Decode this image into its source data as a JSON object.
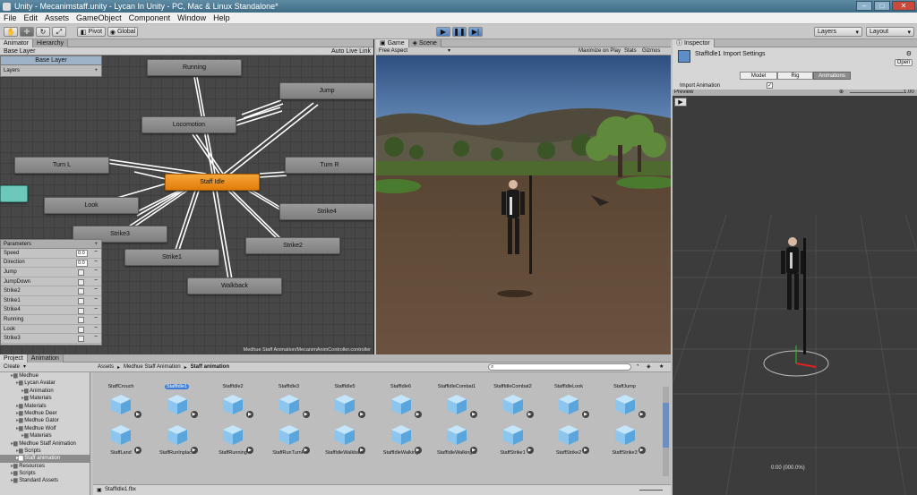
{
  "window": {
    "title": "Unity - Mecanimstaff.unity - Lycan In Unity - PC, Mac & Linux Standalone*"
  },
  "menu": [
    "File",
    "Edit",
    "Assets",
    "GameObject",
    "Component",
    "Window",
    "Help"
  ],
  "toolbar": {
    "pivot": "Pivot",
    "global": "Global",
    "layers": "Layers",
    "layout": "Layout"
  },
  "animator": {
    "tabs": [
      "Animator",
      "Hierarchy"
    ],
    "base_layer_tab": "Base Layer",
    "auto_live_link": "Auto Live Link",
    "layer_name": "Base Layer",
    "layers_label": "Layers",
    "states": [
      "Running",
      "Jump",
      "Locomotion",
      "Turn L",
      "Turn R",
      "Staff Idle",
      "Look",
      "Strike4",
      "Strike3",
      "Strike2",
      "Strike1",
      "Walkback"
    ],
    "params_label": "Parameters",
    "params": [
      {
        "name": "Speed",
        "value": "0.0"
      },
      {
        "name": "Direction",
        "value": "0.0"
      },
      {
        "name": "Jump",
        "value": ""
      },
      {
        "name": "JumpDown",
        "value": ""
      },
      {
        "name": "Strike2",
        "value": ""
      },
      {
        "name": "Strike1",
        "value": ""
      },
      {
        "name": "Strike4",
        "value": ""
      },
      {
        "name": "Running",
        "value": ""
      },
      {
        "name": "Look",
        "value": ""
      },
      {
        "name": "Strike3",
        "value": ""
      }
    ],
    "controller_path": "Medhue Staff Animation/MecanimAnimController.controller"
  },
  "game": {
    "tabs": [
      "Game",
      "Scene"
    ],
    "aspect": "Free Aspect",
    "maximize": "Maximize on Play",
    "stats": "Stats",
    "gizmos": "Gizmos"
  },
  "inspector": {
    "tab": "Inspector",
    "title": "StaffIdle1 Import Settings",
    "open": "Open",
    "tabs": [
      "Model",
      "Rig",
      "Animations"
    ],
    "import_animation": "Import Animation",
    "preview": "Preview",
    "speed": "1.00",
    "time_readout": "0:00 (000.0%)"
  },
  "project": {
    "tabs": [
      "Project",
      "Animation"
    ],
    "create": "Create",
    "breadcrumb": [
      "Assets",
      "Medhue Staff Animation",
      "Staff animation"
    ],
    "tree": [
      {
        "label": "Medhue",
        "indent": 2,
        "sel": false
      },
      {
        "label": "Lycan Avatar",
        "indent": 3,
        "sel": false
      },
      {
        "label": "Animation",
        "indent": 4,
        "sel": false
      },
      {
        "label": "Materials",
        "indent": 4,
        "sel": false
      },
      {
        "label": "Materials",
        "indent": 3,
        "sel": false
      },
      {
        "label": "Medhue Deer",
        "indent": 3,
        "sel": false
      },
      {
        "label": "Medhue Gator",
        "indent": 3,
        "sel": false
      },
      {
        "label": "Medhue Wolf",
        "indent": 3,
        "sel": false
      },
      {
        "label": "Materials",
        "indent": 4,
        "sel": false
      },
      {
        "label": "Medhue Staff Animation",
        "indent": 2,
        "sel": false
      },
      {
        "label": "Scripts",
        "indent": 3,
        "sel": false
      },
      {
        "label": "Staff animation",
        "indent": 3,
        "sel": true
      },
      {
        "label": "Resources",
        "indent": 2,
        "sel": false
      },
      {
        "label": "Scripts",
        "indent": 2,
        "sel": false
      },
      {
        "label": "Standard Assets",
        "indent": 2,
        "sel": false
      }
    ],
    "row1": [
      "StaffCrouch",
      "StaffIdle1",
      "StaffIdle2",
      "StaffIdle3",
      "StaffIdle5",
      "StaffIdle6",
      "StaffIdleCombat1",
      "StaffIdleCombat2",
      "StaffIdleLook",
      "StaffJump"
    ],
    "row2": [
      "StaffLand",
      "StaffRunInplace",
      "StaffRunning",
      "StaffRunTurnR",
      "StaffIdleWalkback",
      "StaffIdleWalking",
      "StaffIdleWalkingIn",
      "StaffStrike1",
      "StaffStrike2",
      "StaffStrike3"
    ],
    "selected_file": "StaffIdle1.fbx"
  }
}
